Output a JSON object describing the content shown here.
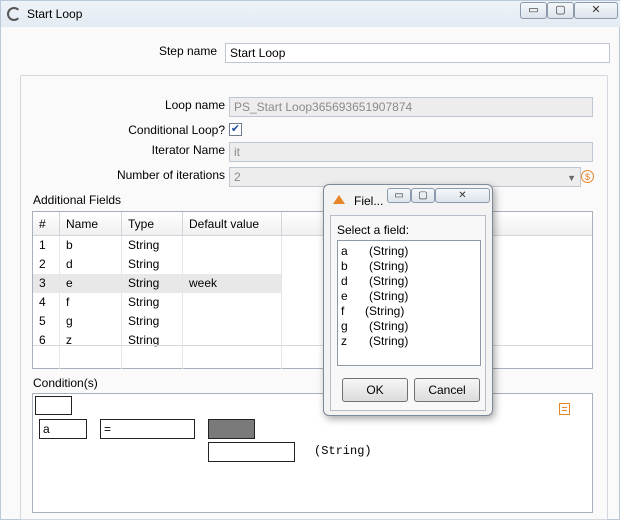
{
  "window": {
    "title": "Start Loop",
    "controls": {
      "minimize": "▭",
      "maximize": "▢",
      "close": "✕"
    }
  },
  "step": {
    "label": "Step name",
    "value": "Start Loop"
  },
  "loop": {
    "loop_name_label": "Loop name",
    "loop_name_value": "PS_Start Loop365693651907874",
    "conditional_label": "Conditional Loop?",
    "conditional_checked": true,
    "iterator_label": "Iterator Name",
    "iterator_value": "it",
    "iterations_label": "Number of iterations",
    "iterations_value": "2"
  },
  "additional_fields": {
    "label": "Additional Fields",
    "columns": [
      "#",
      "Name",
      "Type",
      "Default value"
    ],
    "rows": [
      {
        "n": "1",
        "name": "b",
        "type": "String",
        "default": ""
      },
      {
        "n": "2",
        "name": "d",
        "type": "String",
        "default": ""
      },
      {
        "n": "3",
        "name": "e",
        "type": "String",
        "default": "week"
      },
      {
        "n": "4",
        "name": "f",
        "type": "String",
        "default": ""
      },
      {
        "n": "5",
        "name": "g",
        "type": "String",
        "default": ""
      },
      {
        "n": "6",
        "name": "z",
        "type": "String",
        "default": ""
      }
    ]
  },
  "condition": {
    "label": "Condition(s)",
    "field_value": "a",
    "operator_value": "=",
    "type_hint": "(String)"
  },
  "popup": {
    "title": "Fiel...",
    "prompt": "Select a field:",
    "items": [
      {
        "name": "a",
        "type": "(String)"
      },
      {
        "name": "b",
        "type": "(String)"
      },
      {
        "name": "d",
        "type": "(String)"
      },
      {
        "name": "e",
        "type": "(String)"
      },
      {
        "name": "f",
        "type": "(String)"
      },
      {
        "name": "g",
        "type": "(String)"
      },
      {
        "name": "z",
        "type": "(String)"
      }
    ],
    "ok_label": "OK",
    "cancel_label": "Cancel",
    "controls": {
      "minimize": "▭",
      "maximize": "▢",
      "close": "✕"
    }
  },
  "colors": {
    "accent_icon": "#e8842a",
    "selected_row": "#e8e8e8",
    "title_bar": "#e3ebf3"
  }
}
